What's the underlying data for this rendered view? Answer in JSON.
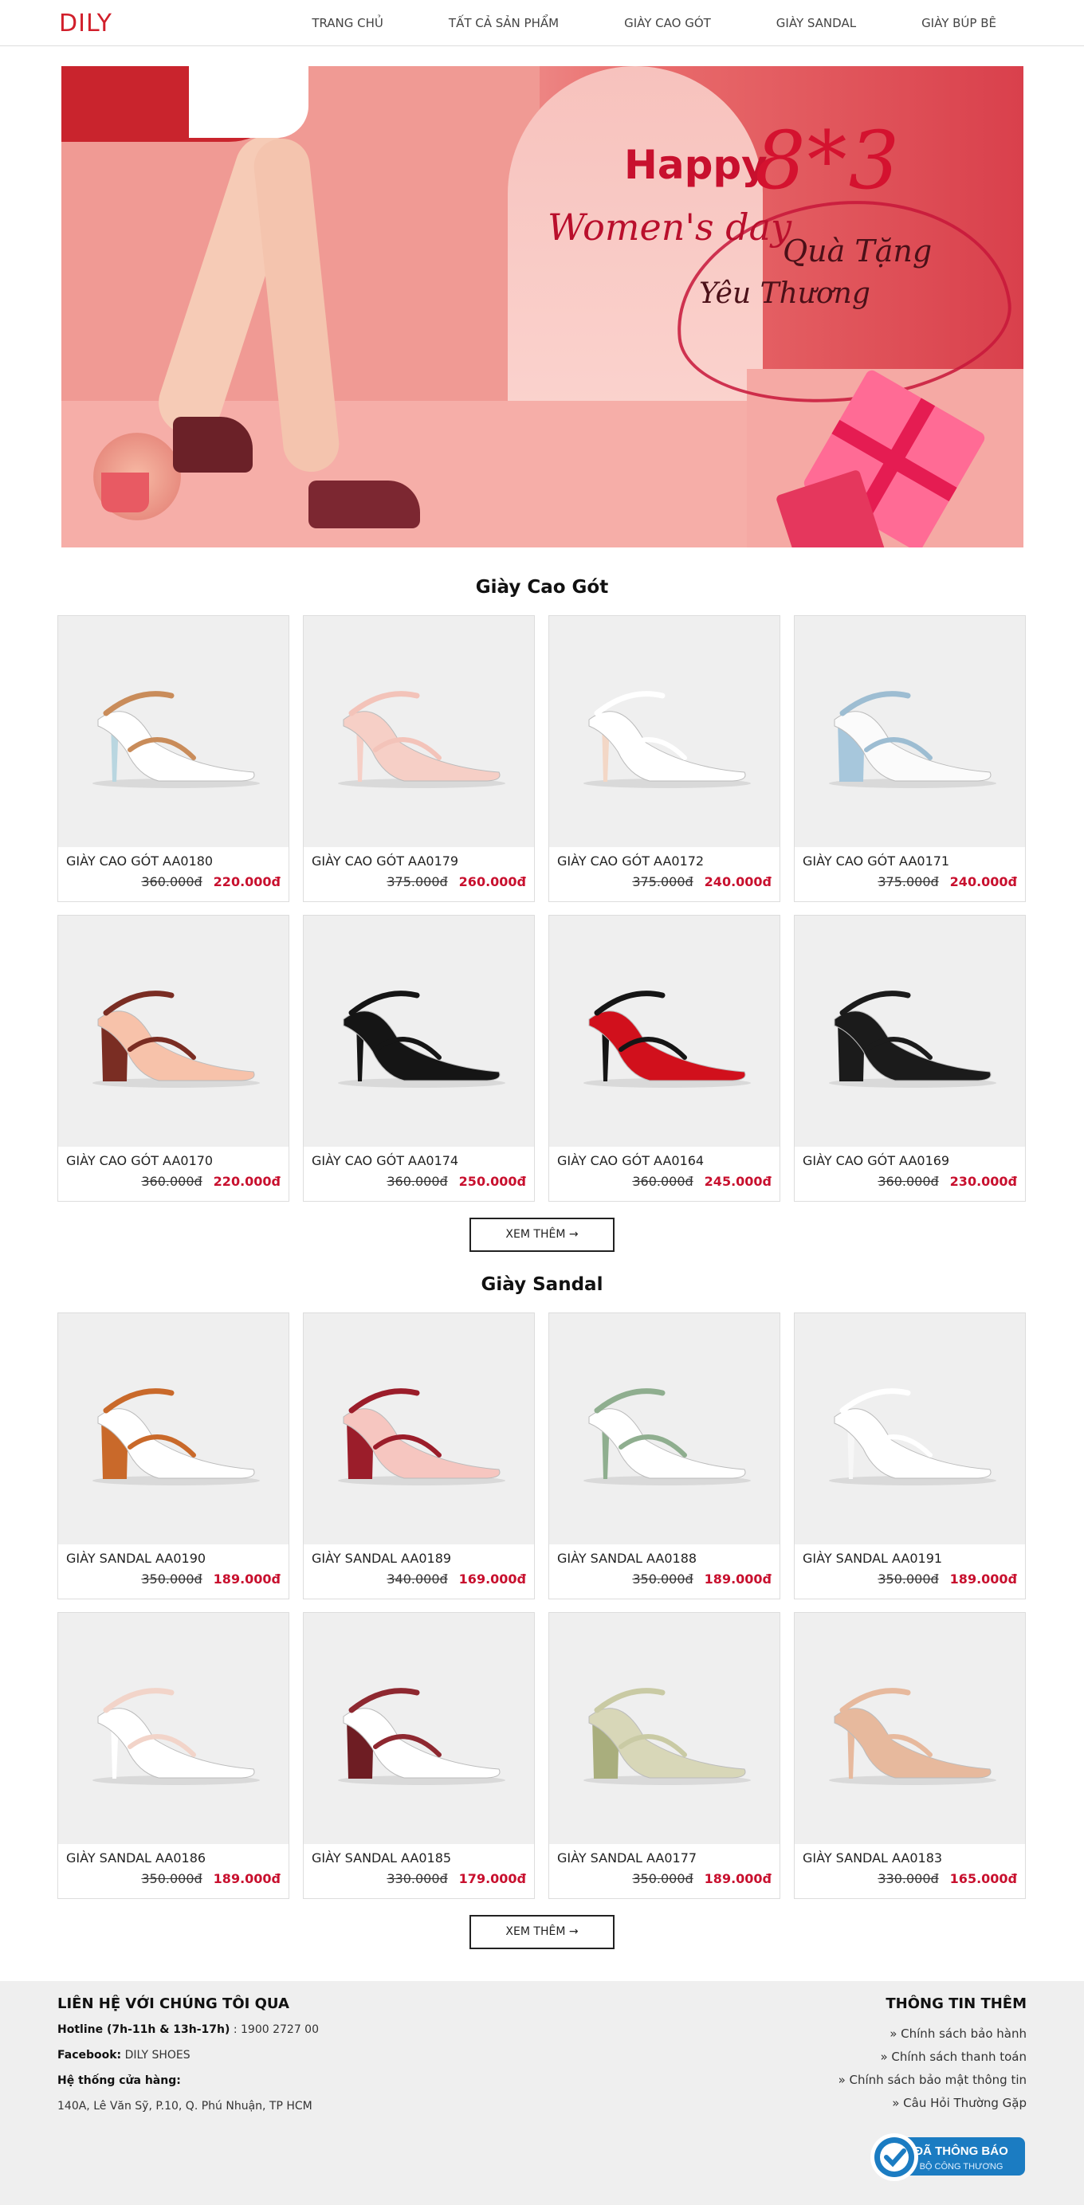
{
  "header": {
    "logo": "DILY",
    "nav": [
      "TRANG CHỦ",
      "TẤT CẢ SẢN PHẨM",
      "GIÀY CAO GÓT",
      "GIÀY SANDAL",
      "GIÀY BÚP BÊ"
    ]
  },
  "banner": {
    "happy": "Happy",
    "date": "8*3",
    "womens_day": "Women's day",
    "line1": "Quà Tặng",
    "line2": "Yêu Thương"
  },
  "sections": [
    {
      "title": "Giày Cao Gót",
      "more": "XEM THÊM →",
      "products": [
        {
          "name": "GIÀY CAO GÓT AA0180",
          "old": "360.000đ",
          "new": "220.000đ",
          "color": "#ffffff",
          "accent": "#c98c5a",
          "heel": "#b9d6e0"
        },
        {
          "name": "GIÀY CAO GÓT AA0179",
          "old": "375.000đ",
          "new": "260.000đ",
          "color": "#f6cfc6",
          "accent": "#f3c3b9",
          "heel": "#f6cfc6"
        },
        {
          "name": "GIÀY CAO GÓT AA0172",
          "old": "375.000đ",
          "new": "240.000đ",
          "color": "#ffffff",
          "accent": "#ffffff",
          "heel": "#f3d7c6"
        },
        {
          "name": "GIÀY CAO GÓT AA0171",
          "old": "375.000đ",
          "new": "240.000đ",
          "color": "#fbfbfb",
          "accent": "#9dbdd2",
          "heel": "#a7c7dc"
        },
        {
          "name": "GIÀY CAO GÓT AA0170",
          "old": "360.000đ",
          "new": "220.000đ",
          "color": "#f7c2aa",
          "accent": "#7a2d23",
          "heel": "#7a2d23"
        },
        {
          "name": "GIÀY CAO GÓT AA0174",
          "old": "360.000đ",
          "new": "250.000đ",
          "color": "#151515",
          "accent": "#151515",
          "heel": "#151515"
        },
        {
          "name": "GIÀY CAO GÓT AA0164",
          "old": "360.000đ",
          "new": "245.000đ",
          "color": "#d1101c",
          "accent": "#151515",
          "heel": "#151515"
        },
        {
          "name": "GIÀY CAO GÓT AA0169",
          "old": "360.000đ",
          "new": "230.000đ",
          "color": "#1b1b1b",
          "accent": "#1b1b1b",
          "heel": "#1b1b1b"
        }
      ]
    },
    {
      "title": "Giày Sandal",
      "more": "XEM THÊM →",
      "products": [
        {
          "name": "GIÀY SANDAL AA0190",
          "old": "350.000đ",
          "new": "189.000đ",
          "color": "#ffffff",
          "accent": "#c9692a",
          "heel": "#c9692a"
        },
        {
          "name": "GIÀY SANDAL AA0189",
          "old": "340.000đ",
          "new": "169.000đ",
          "color": "#f6c6c0",
          "accent": "#9b1d2a",
          "heel": "#9b1d2a"
        },
        {
          "name": "GIÀY SANDAL AA0188",
          "old": "350.000đ",
          "new": "189.000đ",
          "color": "#ffffff",
          "accent": "#8fae8f",
          "heel": "#8fae8f"
        },
        {
          "name": "GIÀY SANDAL AA0191",
          "old": "350.000đ",
          "new": "189.000đ",
          "color": "#ffffff",
          "accent": "#ffffff",
          "heel": "#f7f7f7"
        },
        {
          "name": "GIÀY SANDAL AA0186",
          "old": "350.000đ",
          "new": "189.000đ",
          "color": "#ffffff",
          "accent": "#f2d4c9",
          "heel": "#ffffff"
        },
        {
          "name": "GIÀY SANDAL AA0185",
          "old": "330.000đ",
          "new": "179.000đ",
          "color": "#ffffff",
          "accent": "#8e2830",
          "heel": "#6e1d23"
        },
        {
          "name": "GIÀY SANDAL AA0177",
          "old": "350.000đ",
          "new": "189.000đ",
          "color": "#d8d7b8",
          "accent": "#c9caa4",
          "heel": "#a9ae7d"
        },
        {
          "name": "GIÀY SANDAL AA0183",
          "old": "330.000đ",
          "new": "165.000đ",
          "color": "#e7b99d",
          "accent": "#e7b99d",
          "heel": "#e7b99d"
        }
      ]
    }
  ],
  "footer": {
    "contact_title": "LIÊN HỆ VỚI CHÚNG TÔI QUA",
    "hotline_label": "Hotline (7h-11h & 13h-17h)",
    "hotline_value": " : 1900 2727 00",
    "facebook_label": "Facebook:",
    "facebook_value": " DILY SHOES",
    "stores_label": "Hệ thống cửa hàng:",
    "address": "140A, Lê Văn Sỹ, P.10, Q. Phú Nhuận, TP HCM",
    "info_title": "THÔNG TIN THÊM",
    "links": [
      "» Chính sách bảo hành",
      "» Chính sách thanh toán",
      "» Chính sách bảo mật thông tin",
      "» Câu Hỏi Thường Gặp"
    ],
    "badge_line1": "ĐÃ THÔNG BÁO",
    "badge_line2": "BỘ CÔNG THƯƠNG"
  }
}
